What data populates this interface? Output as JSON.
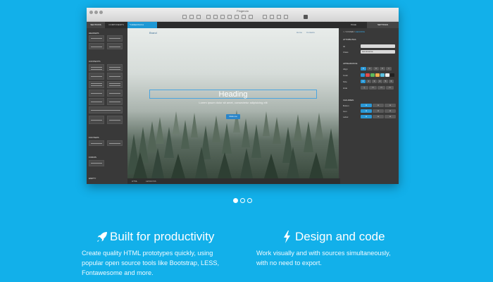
{
  "window": {
    "title": "Pingendo"
  },
  "left_panel": {
    "tabs": [
      "SECTIONS",
      "COMPONENTS"
    ],
    "sections": [
      "HEADERS",
      "CONTENTS",
      "FOOTERS",
      "FORMS",
      "EMPTY"
    ]
  },
  "editor": {
    "file_tab": "*untitled.html ●",
    "status_items": [
      "HTML",
      "LESS/CSS"
    ]
  },
  "preview": {
    "brand": "Brand",
    "nav_links": [
      "Home",
      "Contacts"
    ],
    "heading": "Heading",
    "lead": "Lorem ipsum dolor sit amet, consectetur adipisicing elit",
    "button": "Click me"
  },
  "right_panel": {
    "tabs": [
      "PAGE",
      "SETTINGS"
    ],
    "breadcrumb_prefix": "/ COVER /",
    "breadcrumb_current": "HEADING",
    "attributes_heading": "ATTRIBUTES",
    "attributes": [
      {
        "label": "ID",
        "value": ""
      },
      {
        "label": "Class",
        "value": "text-inverse"
      }
    ],
    "appearance_heading": "APPEARANCE",
    "appearance_rows": [
      "Align",
      "Color",
      "Size",
      "Hide"
    ],
    "size_options": [
      "1",
      "2",
      "3",
      "4",
      "5",
      "6"
    ],
    "children_heading": "CHILDREN",
    "children_rows": [
      "Button",
      "Icon",
      "Label"
    ]
  },
  "carousel": {
    "slide_count": 3,
    "active_index": 0
  },
  "features": [
    {
      "icon": "rocket-icon",
      "title": "Built for productivity",
      "lines": [
        "Create quality HTML prototypes quickly, using",
        "popular open source tools like Bootstrap, LESS,",
        "Fontawesome and more."
      ]
    },
    {
      "icon": "bolt-icon",
      "title": "Design and code",
      "lines": [
        "Work visually and with sources simultaneously,",
        "with no need to export."
      ]
    }
  ],
  "colors": {
    "background": "#12b0ea",
    "accent": "#2a98d6"
  }
}
